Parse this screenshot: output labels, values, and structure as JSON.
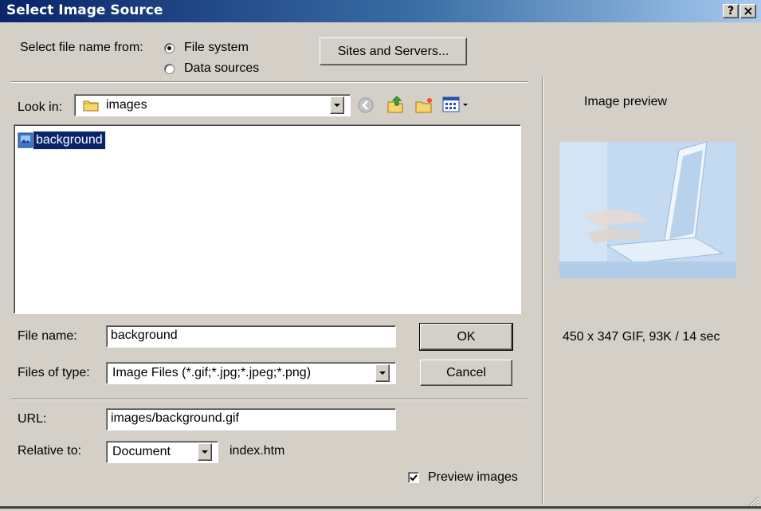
{
  "window": {
    "title": "Select Image Source"
  },
  "titlebar_buttons": {
    "help": "?",
    "close": "×"
  },
  "source": {
    "label": "Select file name from:",
    "options": [
      "File system",
      "Data sources"
    ],
    "selected": "File system"
  },
  "sites_button": "Sites and Servers...",
  "lookin": {
    "label": "Look in:",
    "value": "images"
  },
  "files": [
    {
      "name": "background",
      "selected": true
    }
  ],
  "filename": {
    "label": "File name:",
    "value": "background"
  },
  "filetype": {
    "label": "Files of type:",
    "value": "Image Files (*.gif;*.jpg;*.jpeg;*.png)"
  },
  "ok_button": "OK",
  "cancel_button": "Cancel",
  "url": {
    "label": "URL:",
    "value": "images/background.gif"
  },
  "relative": {
    "label": "Relative to:",
    "value": "Document",
    "file": "index.htm"
  },
  "preview_images": {
    "label": "Preview images",
    "checked": true
  },
  "preview": {
    "title": "Image preview",
    "info": "450 x 347 GIF, 93K / 14 sec"
  },
  "colors": {
    "title_start": "#0a246a",
    "title_end": "#a6caf0",
    "face": "#d4d0c8",
    "selection": "#0a246a"
  }
}
